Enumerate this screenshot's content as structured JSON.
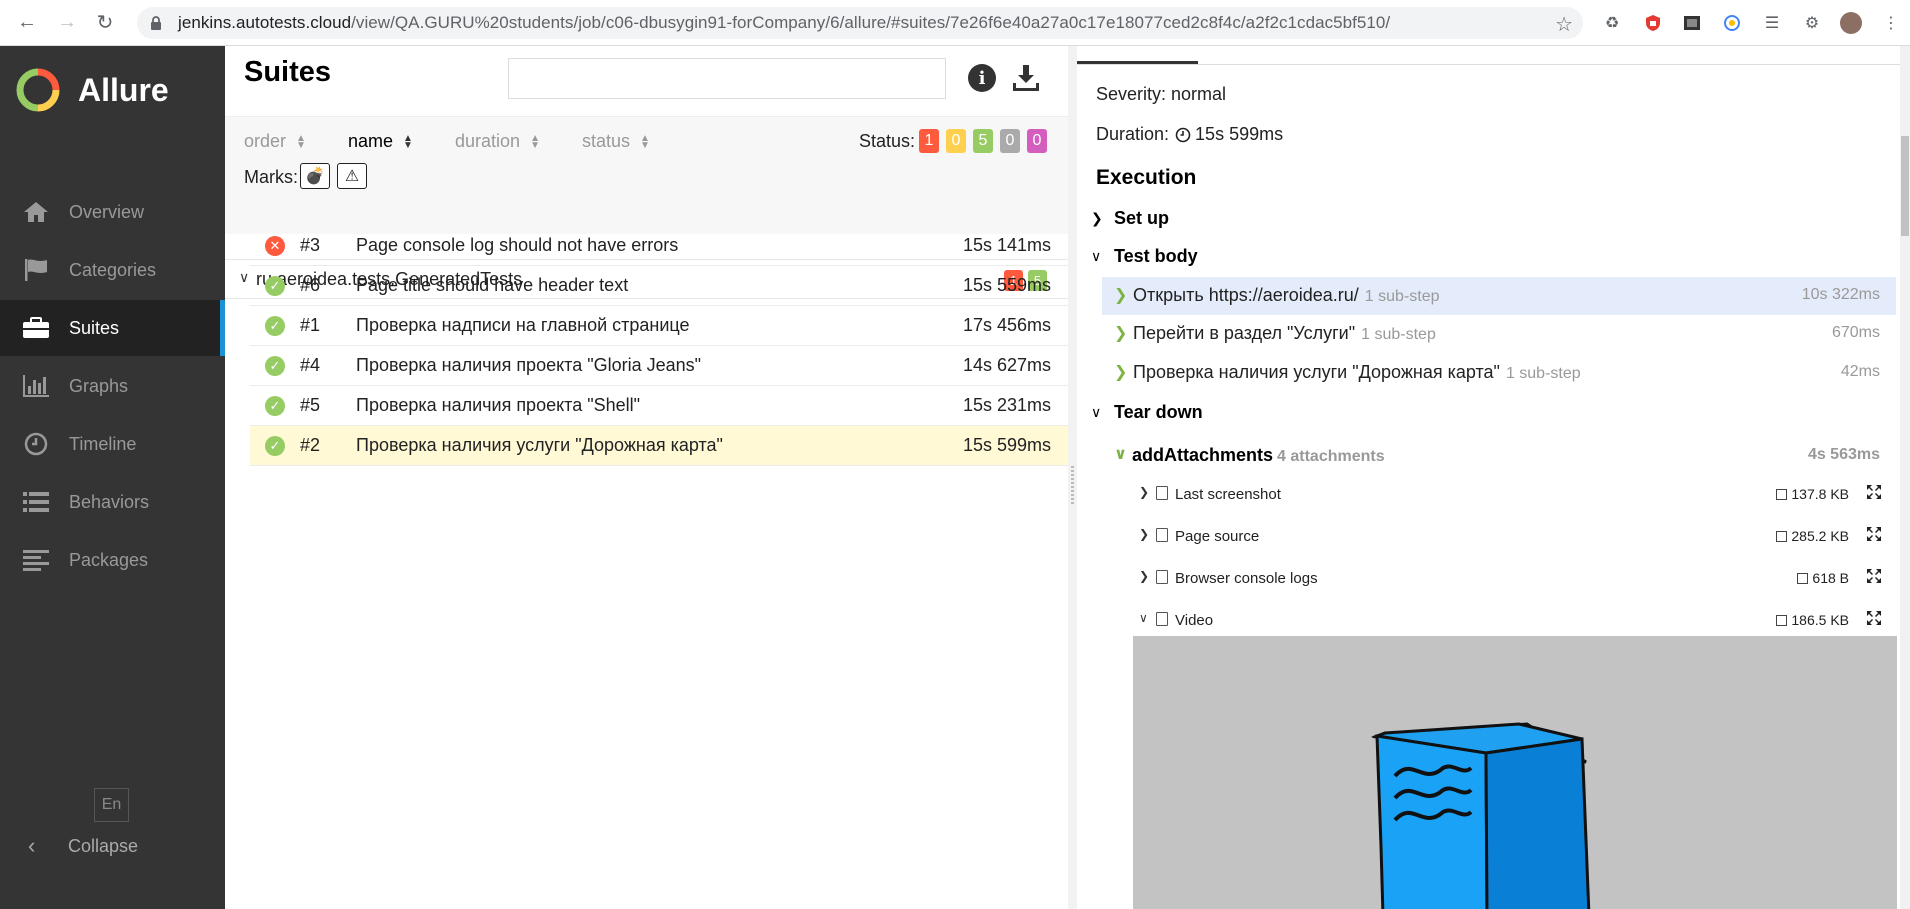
{
  "browser": {
    "url_host": "jenkins.autotests.cloud",
    "url_path": "/view/QA.GURU%20students/job/c06-dbusygin91-forCompany/6/allure/#suites/7e26f6e40a27a0c17e18077ced2c8f4c/a2f2c1cdac5bf510/"
  },
  "sidebar": {
    "brand": "Allure",
    "items": [
      {
        "label": "Overview",
        "icon": "home-icon"
      },
      {
        "label": "Categories",
        "icon": "flag-icon"
      },
      {
        "label": "Suites",
        "icon": "briefcase-icon"
      },
      {
        "label": "Graphs",
        "icon": "bar-chart-icon"
      },
      {
        "label": "Timeline",
        "icon": "clock-icon"
      },
      {
        "label": "Behaviors",
        "icon": "list-icon"
      },
      {
        "label": "Packages",
        "icon": "align-left-icon"
      }
    ],
    "active": "Suites",
    "language": "En",
    "collapse": "Collapse"
  },
  "suites": {
    "title": "Suites",
    "search_value": "",
    "sort": {
      "order": "order",
      "name": "name",
      "duration": "duration",
      "status": "status"
    },
    "status_label": "Status:",
    "status_counts": [
      {
        "value": "1",
        "color": "#fd5a3e"
      },
      {
        "value": "0",
        "color": "#ffd050"
      },
      {
        "value": "5",
        "color": "#97cc64"
      },
      {
        "value": "0",
        "color": "#aaaaaa"
      },
      {
        "value": "0",
        "color": "#d35ebe"
      }
    ],
    "marks_label": "Marks:",
    "group": {
      "name": "ru.aeroidea.tests.GeneratedTests",
      "failed": "1",
      "passed": "5"
    },
    "tests": [
      {
        "num": "#3",
        "name": "Page console log should not have errors",
        "duration": "15s 141ms",
        "status": "failed"
      },
      {
        "num": "#6",
        "name": "Page title should have header text",
        "duration": "15s 559ms",
        "status": "passed"
      },
      {
        "num": "#1",
        "name": "Проверка надписи на главной странице",
        "duration": "17s 456ms",
        "status": "passed"
      },
      {
        "num": "#4",
        "name": "Проверка наличия проекта \"Gloria Jeans\"",
        "duration": "14s 627ms",
        "status": "passed"
      },
      {
        "num": "#5",
        "name": "Проверка наличия проекта \"Shell\"",
        "duration": "15s 231ms",
        "status": "passed"
      },
      {
        "num": "#2",
        "name": "Проверка наличия услуги \"Дорожная карта\"",
        "duration": "15s 599ms",
        "status": "passed"
      }
    ]
  },
  "details": {
    "severity": "Severity: normal",
    "duration_label": "Duration:",
    "duration_value": "15s 599ms",
    "execution": "Execution",
    "setup": "Set up",
    "test_body": "Test body",
    "steps": [
      {
        "name": "Открыть https://aeroidea.ru/",
        "sub": "1 sub-step",
        "duration": "10s 322ms"
      },
      {
        "name": "Перейти в раздел \"Услуги\"",
        "sub": "1 sub-step",
        "duration": "670ms"
      },
      {
        "name": "Проверка наличия услуги \"Дорожная карта\"",
        "sub": "1 sub-step",
        "duration": "42ms"
      }
    ],
    "teardown": "Tear down",
    "add_attachments": {
      "name": "addAttachments",
      "sub": "4 attachments",
      "duration": "4s 563ms"
    },
    "attachments": [
      {
        "name": "Last screenshot",
        "size": "137.8 KB"
      },
      {
        "name": "Page source",
        "size": "285.2 KB"
      },
      {
        "name": "Browser console logs",
        "size": "618 B"
      },
      {
        "name": "Video",
        "size": "186.5 KB"
      }
    ]
  },
  "colors": {
    "accent": "#1a92d4",
    "failed": "#fd5a3e",
    "passed": "#97cc64"
  }
}
